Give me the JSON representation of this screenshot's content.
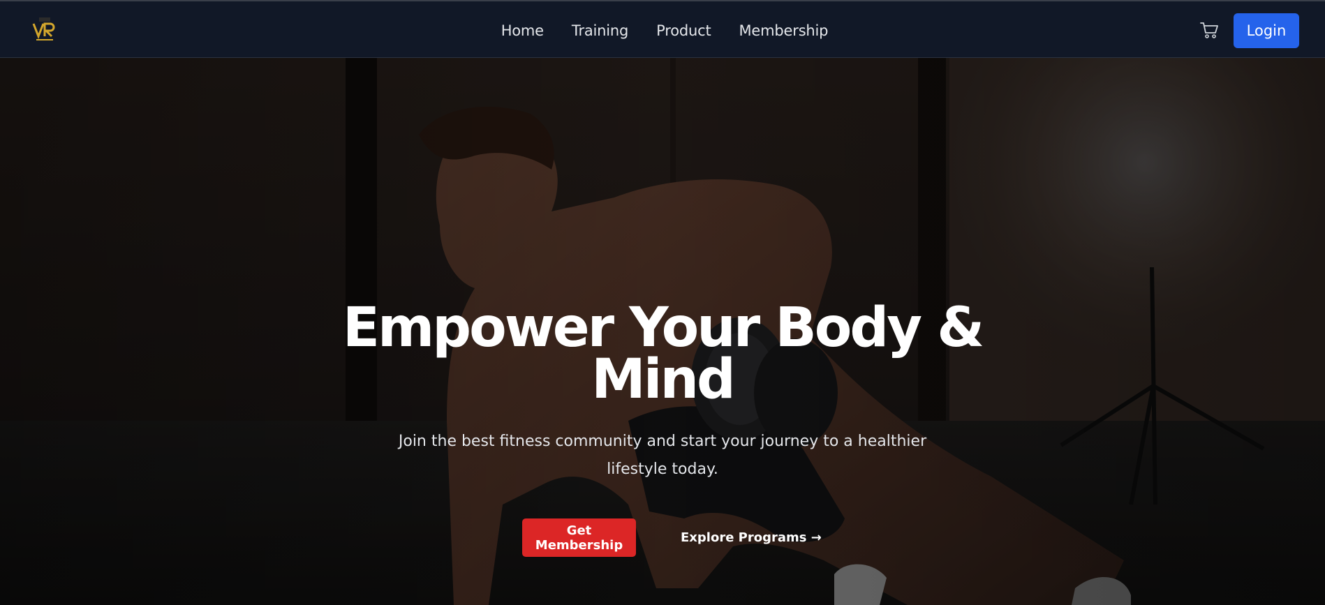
{
  "header": {
    "logo_icon": "vr-gym-logo",
    "nav": [
      {
        "label": "Home"
      },
      {
        "label": "Training"
      },
      {
        "label": "Product"
      },
      {
        "label": "Membership"
      }
    ],
    "cart_icon": "shopping-cart-icon",
    "login_label": "Login"
  },
  "hero": {
    "headline_line1": "Empower Your Body &",
    "headline_line2": "Mind",
    "subtext": "Join the best fitness community and start your journey to a healthier lifestyle today.",
    "primary_cta": "Get Membership",
    "secondary_cta": "Explore Programs →",
    "background_image": "man-doing-dumbbell-pushup-in-industrial-gym"
  },
  "colors": {
    "nav_bg": "#111827",
    "login_bg": "#2563eb",
    "cta_bg": "#dc2626",
    "text": "#ffffff"
  }
}
